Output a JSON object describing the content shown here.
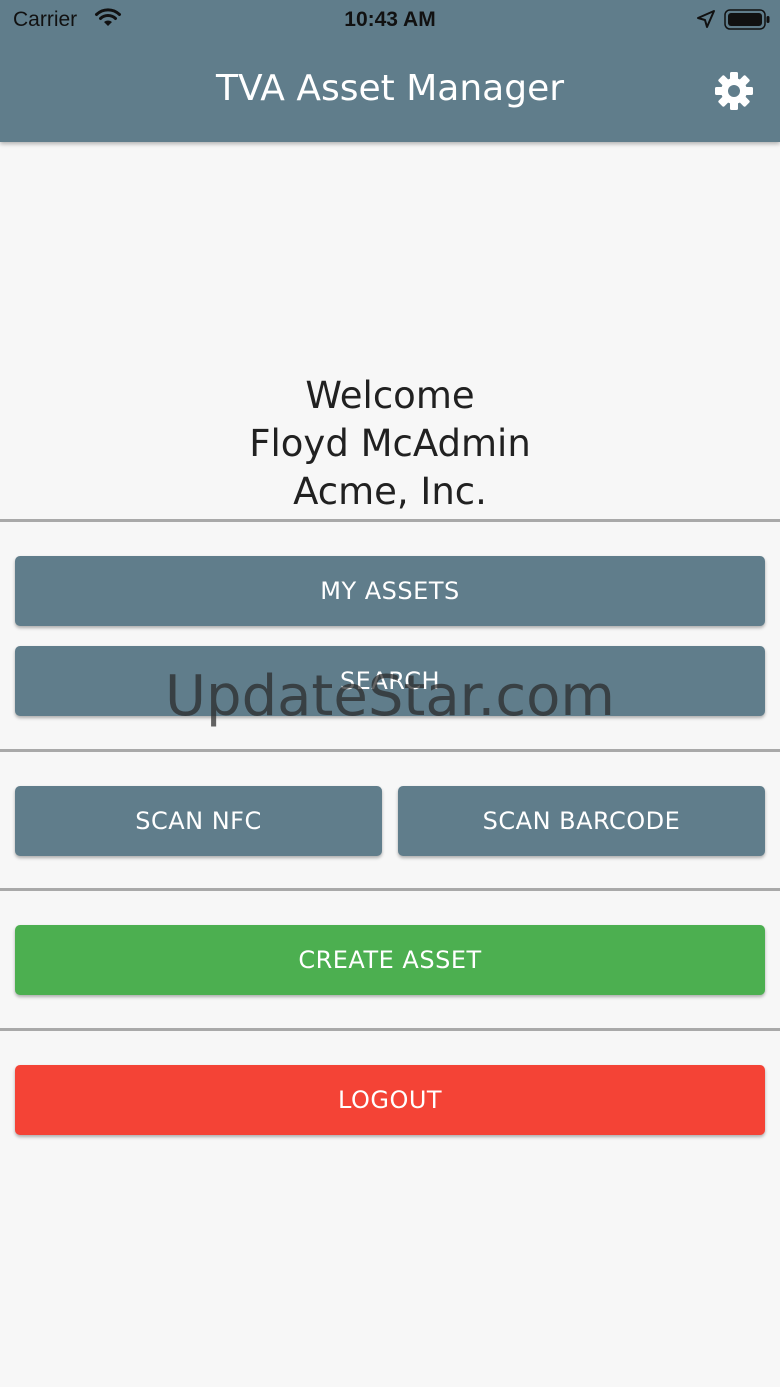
{
  "status_bar": {
    "carrier": "Carrier",
    "time": "10:43 AM"
  },
  "app_bar": {
    "title": "TVA Asset Manager",
    "settings_icon": "gear-icon",
    "color": "#607d8b"
  },
  "welcome": {
    "greeting": "Welcome",
    "user_name": "Floyd McAdmin",
    "company": "Acme, Inc."
  },
  "buttons": {
    "my_assets": "MY ASSETS",
    "search": "SEARCH",
    "scan_nfc": "SCAN NFC",
    "scan_barcode": "SCAN BARCODE",
    "create_asset": "CREATE ASSET",
    "logout": "LOGOUT"
  },
  "colors": {
    "primary": "#607d8b",
    "create": "#4caf50",
    "logout": "#f44336"
  },
  "watermark": "UpdateStar.com"
}
